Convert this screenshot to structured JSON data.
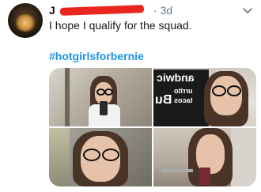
{
  "tweet": {
    "author_initial": "J",
    "timestamp": "3d",
    "text": "I hope I qualify for the squad.",
    "hashtag": "#hotgirlsforbernie"
  },
  "media": {
    "sign_text_top": "andwic",
    "sign_text_mid": "urrito",
    "sign_text_low": "Bu",
    "sign_text_right": "tacos"
  },
  "colors": {
    "hashtag": "#1b95e0",
    "text": "#14171a",
    "muted": "#657786",
    "redaction": "#e8251e"
  },
  "icons": {
    "more": "chevron-down-icon"
  }
}
